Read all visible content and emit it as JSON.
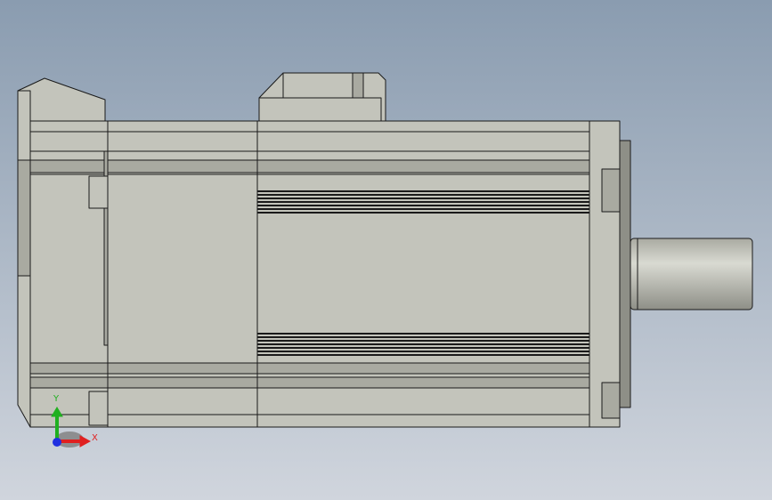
{
  "viewport": {
    "background_top": "#8a9cb0",
    "background_bottom": "#d0d5dd"
  },
  "model": {
    "body_color": "#c3c4bb",
    "body_shade": "#a9aaa1",
    "body_dark": "#8e8f87",
    "edge_color": "#1a1a1a",
    "shaft_highlight": "#d9dad2",
    "groove_count": 7
  },
  "triad": {
    "x_label": "X",
    "y_label": "Y",
    "x_color": "#e02020",
    "y_color": "#20b020",
    "z_color": "#2030e0"
  }
}
